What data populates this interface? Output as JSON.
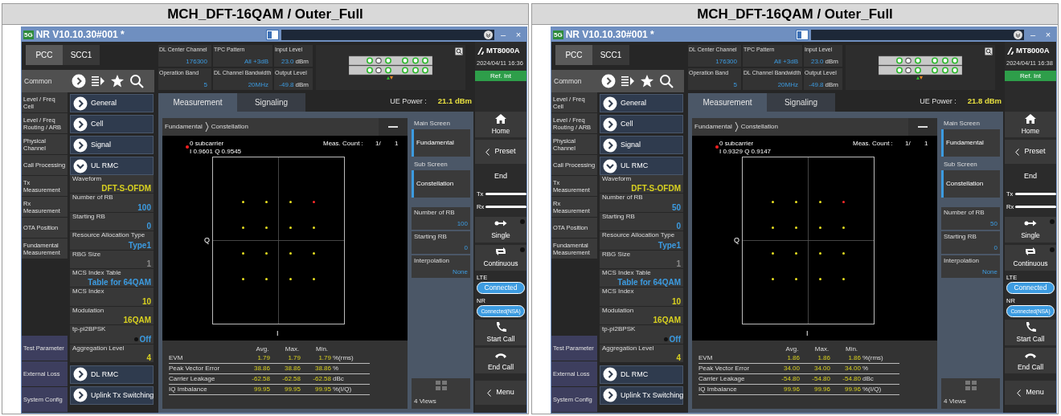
{
  "panels": [
    {
      "heading": "MCH_DFT-16QAM / Outer_Full",
      "window": {
        "badge": "5G",
        "title": "NR V10.10.30#001 *",
        "controls": [
          "–",
          "×"
        ]
      },
      "carrier_tabs": [
        {
          "label": "PCC",
          "selected": true
        },
        {
          "label": "SCC1",
          "selected": false
        }
      ],
      "common_label": "Common",
      "nav_items": [
        "Level / Freq Cell",
        "Level / Freq Routing / ARB",
        "Physical Channel",
        "Call Processing",
        "Tx Measurement",
        "Rx Measurement",
        "OTA Position",
        "Fundamental Measurement"
      ],
      "nav_bottom_items": [
        "Test Parameter",
        "External Loss",
        "System Config"
      ],
      "sections": [
        {
          "label": "General",
          "expanded": false
        },
        {
          "label": "Cell",
          "expanded": false
        },
        {
          "label": "Signal",
          "expanded": false
        },
        {
          "label": "UL RMC",
          "expanded": true,
          "params": [
            {
              "name": "Waveform",
              "value": "DFT-S-OFDM",
              "color": "#d8d020"
            },
            {
              "name": "Number of RB",
              "value": "100",
              "color": "#3c9be0"
            },
            {
              "name": "Starting RB",
              "value": "0",
              "color": "#3c9be0"
            },
            {
              "name": "Resource Allocation Type",
              "value": "Type1",
              "color": "#3c9be0"
            },
            {
              "name": "RBG Size",
              "value": "1",
              "color": "#8a8a8a"
            },
            {
              "name": "MCS Index Table",
              "value": "Table for 64QAM",
              "color": "#3c9be0"
            },
            {
              "name": "MCS Index",
              "value": "10",
              "color": "#d8d020"
            },
            {
              "name": "Modulation",
              "value": "16QAM",
              "color": "#d8d020"
            },
            {
              "name": "tp-pi2BPSK",
              "value": "Off",
              "color": "#3c9be0",
              "kind": "toggle",
              "on": false
            },
            {
              "name": "Aggregation Level",
              "value": "4",
              "color": "#d8d020"
            }
          ]
        },
        {
          "label": "DL RMC",
          "expanded": false
        },
        {
          "label": "Uplink Tx Switching",
          "expanded": false
        }
      ],
      "info": [
        {
          "label": "DL Center Channel",
          "value": "176300"
        },
        {
          "label": "TPC Pattern",
          "value": "All +3dB"
        },
        {
          "label": "Input Level",
          "value": "23.0",
          "unit": "dBm"
        },
        {
          "label": "Operation Band",
          "value": "5"
        },
        {
          "label": "DL Channel Bandwidth",
          "value": "20MHz"
        },
        {
          "label": "Output Level",
          "value": "-49.8",
          "unit": "dBm"
        }
      ],
      "instrument": {
        "model": "MT8000A",
        "datetime": "2024/04/11 16:36",
        "reference": "Ref. Int"
      },
      "view_tabs": [
        {
          "label": "Measurement",
          "selected": true
        },
        {
          "label": "Signaling",
          "selected": false
        }
      ],
      "ue_power": {
        "label": "UE Power :",
        "value": "21.1 dBm"
      },
      "breadcrumb": [
        "Fundamental",
        "Constellation"
      ],
      "marker": {
        "label": "0 subcarrier",
        "value": "I 0.9601 Q 0.9545"
      },
      "meas_count": {
        "label": "Meas. Count :",
        "current": "1/",
        "total": "1"
      },
      "axes": {
        "y": "Q",
        "x": "I"
      },
      "results": {
        "columns": [
          "Avg.",
          "Max.",
          "Min."
        ],
        "rows": [
          {
            "name": "EVM",
            "avg": "1.79",
            "max": "1.79",
            "min": "1.79",
            "unit": "%(rms)"
          },
          {
            "name": "Peak Vector Error",
            "avg": "38.86",
            "max": "38.86",
            "min": "38.86",
            "unit": "%"
          },
          {
            "name": "Carrier Leakage",
            "avg": "-62.58",
            "max": "-62.58",
            "min": "-62.58",
            "unit": "dBc"
          },
          {
            "name": "IQ Imbalance",
            "avg": "99.95",
            "max": "99.95",
            "min": "99.95",
            "unit": "%(I/Q)"
          }
        ]
      },
      "screen_keys": [
        {
          "heading": "Main Screen",
          "label": "Fundamental"
        },
        {
          "heading": "Sub Screen",
          "label": "Constellation"
        }
      ],
      "param_keys": [
        {
          "name": "Number of RB",
          "value": "100"
        },
        {
          "name": "Starting RB",
          "value": "0"
        },
        {
          "name": "Interpolation",
          "value": "None"
        }
      ],
      "views_key": "4 Views",
      "controls": [
        {
          "kind": "home",
          "label": "Home"
        },
        {
          "kind": "back",
          "label": "Preset"
        },
        {
          "kind": "plain",
          "label": "End"
        },
        {
          "kind": "links",
          "labels": [
            "Tx",
            "Rx"
          ]
        },
        {
          "kind": "single",
          "label": "Single"
        },
        {
          "kind": "continuous",
          "label": "Continuous"
        },
        {
          "kind": "status",
          "label": "LTE",
          "value": "Connected"
        },
        {
          "kind": "status",
          "label": "NR",
          "value": "Connected(NSA)"
        },
        {
          "kind": "call",
          "label": "Start Call"
        },
        {
          "kind": "hangup",
          "label": "End Call"
        },
        {
          "kind": "back",
          "label": "Menu"
        }
      ]
    },
    {
      "heading": "MCH_DFT-16QAM / Outer_Full",
      "window": {
        "badge": "5G",
        "title": "NR V10.10.30#001 *",
        "controls": [
          "–",
          "×"
        ]
      },
      "carrier_tabs": [
        {
          "label": "PCC",
          "selected": true
        },
        {
          "label": "SCC1",
          "selected": false
        }
      ],
      "common_label": "Common",
      "nav_items": [
        "Level / Freq Cell",
        "Level / Freq Routing / ARB",
        "Physical Channel",
        "Call Processing",
        "Tx Measurement",
        "Rx Measurement",
        "OTA Position",
        "Fundamental Measurement"
      ],
      "nav_bottom_items": [
        "Test Parameter",
        "External Loss",
        "System Config"
      ],
      "sections": [
        {
          "label": "General",
          "expanded": false
        },
        {
          "label": "Cell",
          "expanded": false
        },
        {
          "label": "Signal",
          "expanded": false
        },
        {
          "label": "UL RMC",
          "expanded": true,
          "params": [
            {
              "name": "Waveform",
              "value": "DFT-S-OFDM",
              "color": "#d8d020"
            },
            {
              "name": "Number of RB",
              "value": "50",
              "color": "#3c9be0"
            },
            {
              "name": "Starting RB",
              "value": "0",
              "color": "#3c9be0"
            },
            {
              "name": "Resource Allocation Type",
              "value": "Type1",
              "color": "#3c9be0"
            },
            {
              "name": "RBG Size",
              "value": "1",
              "color": "#8a8a8a"
            },
            {
              "name": "MCS Index Table",
              "value": "Table for 64QAM",
              "color": "#3c9be0"
            },
            {
              "name": "MCS Index",
              "value": "10",
              "color": "#d8d020"
            },
            {
              "name": "Modulation",
              "value": "16QAM",
              "color": "#d8d020"
            },
            {
              "name": "tp-pi2BPSK",
              "value": "Off",
              "color": "#3c9be0",
              "kind": "toggle",
              "on": false
            },
            {
              "name": "Aggregation Level",
              "value": "4",
              "color": "#d8d020"
            }
          ]
        },
        {
          "label": "DL RMC",
          "expanded": false
        },
        {
          "label": "Uplink Tx Switching",
          "expanded": false
        }
      ],
      "info": [
        {
          "label": "DL Center Channel",
          "value": "176300"
        },
        {
          "label": "TPC Pattern",
          "value": "All +3dB"
        },
        {
          "label": "Input Level",
          "value": "23.0",
          "unit": "dBm"
        },
        {
          "label": "Operation Band",
          "value": "5"
        },
        {
          "label": "DL Channel Bandwidth",
          "value": "20MHz"
        },
        {
          "label": "Output Level",
          "value": "-49.8",
          "unit": "dBm"
        }
      ],
      "instrument": {
        "model": "MT8000A",
        "datetime": "2024/04/11 16:38",
        "reference": "Ref. Int"
      },
      "view_tabs": [
        {
          "label": "Measurement",
          "selected": true
        },
        {
          "label": "Signaling",
          "selected": false
        }
      ],
      "ue_power": {
        "label": "UE Power :",
        "value": "21.8 dBm"
      },
      "breadcrumb": [
        "Fundamental",
        "Constellation"
      ],
      "marker": {
        "label": "0 subcarrier",
        "value": "I 0.9329 Q 0.9147"
      },
      "meas_count": {
        "label": "Meas. Count :",
        "current": "1/",
        "total": "1"
      },
      "axes": {
        "y": "Q",
        "x": "I"
      },
      "results": {
        "columns": [
          "Avg.",
          "Max.",
          "Min."
        ],
        "rows": [
          {
            "name": "EVM",
            "avg": "1.86",
            "max": "1.86",
            "min": "1.86",
            "unit": "%(rms)"
          },
          {
            "name": "Peak Vector Error",
            "avg": "34.00",
            "max": "34.00",
            "min": "34.00",
            "unit": "%"
          },
          {
            "name": "Carrier Leakage",
            "avg": "-54.80",
            "max": "-54.80",
            "min": "-54.80",
            "unit": "dBc"
          },
          {
            "name": "IQ Imbalance",
            "avg": "99.96",
            "max": "99.96",
            "min": "99.96",
            "unit": "%(I/Q)"
          }
        ]
      },
      "screen_keys": [
        {
          "heading": "Main Screen",
          "label": "Fundamental"
        },
        {
          "heading": "Sub Screen",
          "label": "Constellation"
        }
      ],
      "param_keys": [
        {
          "name": "Number of RB",
          "value": "50"
        },
        {
          "name": "Starting RB",
          "value": "0"
        },
        {
          "name": "Interpolation",
          "value": "None"
        }
      ],
      "views_key": "4 Views",
      "controls": [
        {
          "kind": "home",
          "label": "Home"
        },
        {
          "kind": "back",
          "label": "Preset"
        },
        {
          "kind": "plain",
          "label": "End"
        },
        {
          "kind": "links",
          "labels": [
            "Tx",
            "Rx"
          ]
        },
        {
          "kind": "single",
          "label": "Single"
        },
        {
          "kind": "continuous",
          "label": "Continuous"
        },
        {
          "kind": "status",
          "label": "LTE",
          "value": "Connected"
        },
        {
          "kind": "status",
          "label": "NR",
          "value": "Connected(NSA)"
        },
        {
          "kind": "call",
          "label": "Start Call"
        },
        {
          "kind": "hangup",
          "label": "End Call"
        },
        {
          "kind": "back",
          "label": "Menu"
        }
      ]
    }
  ]
}
